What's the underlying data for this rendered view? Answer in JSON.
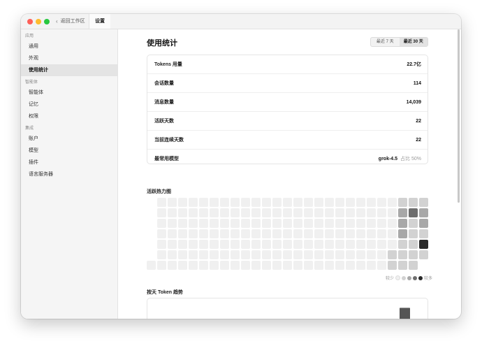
{
  "titlebar": {
    "back_label": "返回工作区",
    "tab_title": "设置"
  },
  "sidebar": {
    "groups": [
      {
        "label": "应用",
        "items": [
          {
            "label": "通用"
          },
          {
            "label": "外观"
          },
          {
            "label": "使用统计"
          }
        ]
      },
      {
        "label": "智能体",
        "items": [
          {
            "label": "智能体"
          },
          {
            "label": "记忆"
          },
          {
            "label": "权限"
          }
        ]
      },
      {
        "label": "集成",
        "items": [
          {
            "label": "账户"
          },
          {
            "label": "模型"
          },
          {
            "label": "插件"
          },
          {
            "label": "语言服务器"
          }
        ]
      }
    ],
    "active_item": "使用统计"
  },
  "main": {
    "title": "使用统计",
    "range_options": [
      "最近 7 天",
      "最近 30 天"
    ],
    "range_selected": "最近 30 天",
    "stats": [
      {
        "label": "Tokens 用量",
        "value": "22.7亿"
      },
      {
        "label": "会话数量",
        "value": "114"
      },
      {
        "label": "消息数量",
        "value": "14,039"
      },
      {
        "label": "活跃天数",
        "value": "22"
      },
      {
        "label": "当前连续天数",
        "value": "22"
      },
      {
        "label": "最常用模型",
        "value": "grok-4.5",
        "sub": "占比 50%"
      }
    ],
    "heatmap": {
      "title": "活跃热力图",
      "legend_less": "较少",
      "legend_more": "较多",
      "levels": [
        [
          null,
          0,
          0,
          0,
          0,
          0,
          0,
          0,
          0,
          0,
          0,
          0,
          0,
          0,
          0,
          0,
          0,
          0,
          0,
          0,
          0,
          0,
          0,
          0,
          1,
          1,
          1
        ],
        [
          null,
          0,
          0,
          0,
          0,
          0,
          0,
          0,
          0,
          0,
          0,
          0,
          0,
          0,
          0,
          0,
          0,
          0,
          0,
          0,
          0,
          0,
          0,
          0,
          2,
          3,
          2
        ],
        [
          null,
          0,
          0,
          0,
          0,
          0,
          0,
          0,
          0,
          0,
          0,
          0,
          0,
          0,
          0,
          0,
          0,
          0,
          0,
          0,
          0,
          0,
          0,
          0,
          2,
          1,
          2
        ],
        [
          null,
          0,
          0,
          0,
          0,
          0,
          0,
          0,
          0,
          0,
          0,
          0,
          0,
          0,
          0,
          0,
          0,
          0,
          0,
          0,
          0,
          0,
          0,
          0,
          2,
          1,
          1
        ],
        [
          null,
          0,
          0,
          0,
          0,
          0,
          0,
          0,
          0,
          0,
          0,
          0,
          0,
          0,
          0,
          0,
          0,
          0,
          0,
          0,
          0,
          0,
          0,
          0,
          1,
          1,
          4
        ],
        [
          null,
          0,
          0,
          0,
          0,
          0,
          0,
          0,
          0,
          0,
          0,
          0,
          0,
          0,
          0,
          0,
          0,
          0,
          0,
          0,
          0,
          0,
          0,
          1,
          1,
          1,
          1
        ],
        [
          0,
          0,
          0,
          0,
          0,
          0,
          0,
          0,
          0,
          0,
          0,
          0,
          0,
          0,
          0,
          0,
          0,
          0,
          0,
          0,
          0,
          0,
          0,
          1,
          1,
          1,
          null
        ]
      ],
      "colors": [
        "#f0f0f0",
        "#d2d2d2",
        "#a8a8a8",
        "#6e6e6e",
        "#2a2a2a"
      ]
    },
    "trend": {
      "title": "按天 Token 趋势"
    }
  }
}
